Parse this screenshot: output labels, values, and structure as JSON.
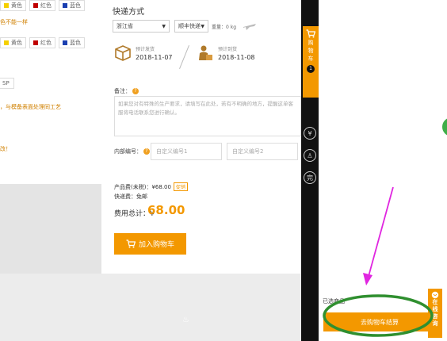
{
  "left": {
    "color_row_1": [
      {
        "name": "黄色",
        "color": "#f5d000"
      },
      {
        "name": "红色",
        "color": "#c00000"
      },
      {
        "name": "蓝色",
        "color": "#1a3fb0"
      }
    ],
    "text_1": "色不能一样",
    "color_row_2": [
      {
        "name": "黄色",
        "color": "#f5d000"
      },
      {
        "name": "红色",
        "color": "#c00000"
      },
      {
        "name": "蓝色",
        "color": "#1a3fb0"
      }
    ],
    "text_sp": "SP",
    "text_2": "，与模备表面处理同工艺",
    "text_3": "改！"
  },
  "shipping": {
    "title": "快递方式",
    "province": "浙江省",
    "carrier": "顺丰快递",
    "weight": "重量：0 kg"
  },
  "dispatch": {
    "label": "预计发货",
    "date": "2018-11-07"
  },
  "arrival": {
    "label": "预计到货",
    "date": "2018-11-08"
  },
  "remark": {
    "label": "备注：",
    "placeholder": "如果您对有特殊的生产要求，请填写在此处，若有不明确的地方，提醒这单客服将电话联系您进行确认。"
  },
  "internal_code": {
    "label": "内部编号：",
    "placeholder_1": "自定义编号1",
    "placeholder_2": "自定义编号2"
  },
  "price": {
    "product_fee": "产品费(未税)：¥68.00",
    "product_tag": "促销",
    "shipping_fee": "快递费：免邮",
    "total_label": "费用总计：¥",
    "total_value": "68.00"
  },
  "add_to_cart": "加入购物车",
  "sidebar": {
    "cart_label": [
      "购",
      "物",
      "车"
    ],
    "cart_count": "1",
    "icons": [
      "¥",
      "♙",
      "完"
    ]
  },
  "drawer": {
    "selected_label": "已选商品",
    "checkout": "去购物车结算"
  },
  "service": [
    "在",
    "线",
    "咨",
    "询"
  ],
  "colors": {
    "accent": "#f39800",
    "annotation": "#e026e0",
    "ring": "#2f8f2f"
  }
}
